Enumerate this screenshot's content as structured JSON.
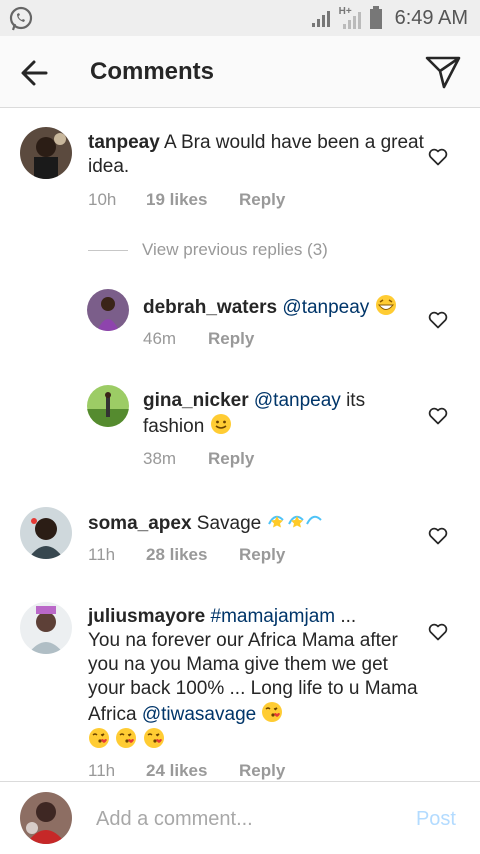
{
  "status_bar": {
    "time": "6:49 AM",
    "network_label": "H+",
    "icons": [
      "whatsapp-icon",
      "signal-icon",
      "signal-icon",
      "battery-icon"
    ]
  },
  "app_bar": {
    "title": "Comments",
    "back_icon": "back-arrow-icon",
    "send_icon": "send-icon"
  },
  "comments": [
    {
      "username": "tanpeay",
      "text": " A Bra would have been a great idea.",
      "time": "10h",
      "likes": "19 likes",
      "reply": "Reply"
    },
    {
      "view_previous": "View previous replies (3)"
    },
    {
      "username": "debrah_waters",
      "mention": "@tanpeay",
      "text": "",
      "emoji": "grinning-face",
      "time": "46m",
      "reply": "Reply"
    },
    {
      "username": "gina_nicker",
      "mention": "@tanpeay",
      "text": " its fashion ",
      "emoji": "smiling-face",
      "time": "38m",
      "reply": "Reply"
    },
    {
      "username": "soma_apex",
      "text": " Savage ",
      "emoji": "dizzy-stars",
      "time": "11h",
      "likes": "28 likes",
      "reply": "Reply"
    },
    {
      "username": "juliusmayore",
      "mention": "#mamajamjam",
      "text_line1": " ...",
      "text_body": "You na forever our Africa Mama after you na you  Mama give them we get your back 100% ... Long life to u Mama Africa ",
      "mention2": "@tiwasavage",
      "emoji": "kissing-face",
      "time": "11h",
      "likes": "24 likes",
      "reply": "Reply"
    }
  ],
  "bottom_bar": {
    "placeholder": "Add a comment...",
    "post_label": "Post"
  },
  "colors": {
    "text": "#262626",
    "meta": "#999999",
    "mention": "#003569",
    "post_disabled": "#b3dbff",
    "divider": "#dbdbdb"
  }
}
